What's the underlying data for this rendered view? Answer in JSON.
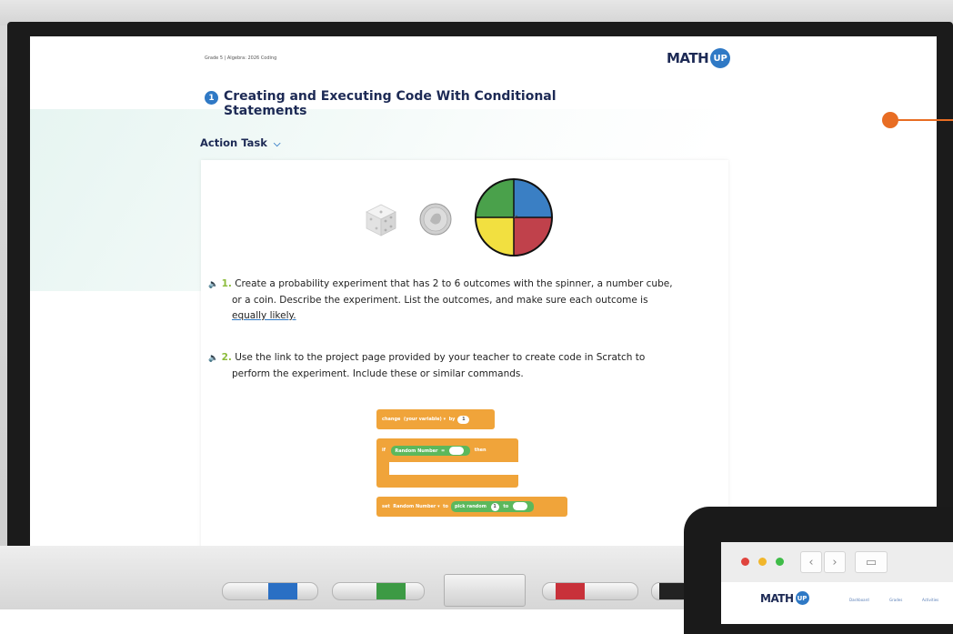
{
  "lesson": {
    "breadcrumb": "Grade 5 | Algebra: 2026 Coding",
    "logo_text": "MATH",
    "logo_badge": "UP",
    "title_number": "1",
    "title": "Creating and Executing Code With Conditional Statements",
    "section_label": "Action Task",
    "section_chevron": "⌵"
  },
  "questions": [
    {
      "number": "1.",
      "line1": "Create a probability experiment that has 2 to 6 outcomes with the spinner, a number cube,",
      "line2": "or a coin. Describe the experiment. List the outcomes, and make sure each outcome is",
      "line3": "equally likely."
    },
    {
      "number": "2.",
      "line1": "Use the link to the project page provided by your teacher to create code in Scratch to",
      "line2": "perform the experiment. Include these or similar commands."
    }
  ],
  "blocks": {
    "change": "change",
    "your_variable": "(your variable) ▾",
    "by": "by",
    "by_value": "1",
    "if": "if",
    "random_number": "Random Number",
    "equals": "=",
    "then": "then",
    "set": "set",
    "set_var": "Random Number ▾",
    "to": "to",
    "pick_random": "pick random",
    "pick_from": "1",
    "pick_to_word": "to"
  },
  "spinner_colors": [
    "#3a7fc4",
    "#c0414b",
    "#f2e040",
    "#4aa14b"
  ],
  "tablet": {
    "logo_text": "MATH",
    "logo_badge": "UP",
    "menu": [
      "Dashboard",
      "Grades",
      "Activities"
    ],
    "dots": [
      "#e0443e",
      "#f1b62b",
      "#3fbc48"
    ],
    "back": "‹",
    "forward": "›",
    "sidebar": "▭"
  },
  "callout_color": "#e86d23"
}
